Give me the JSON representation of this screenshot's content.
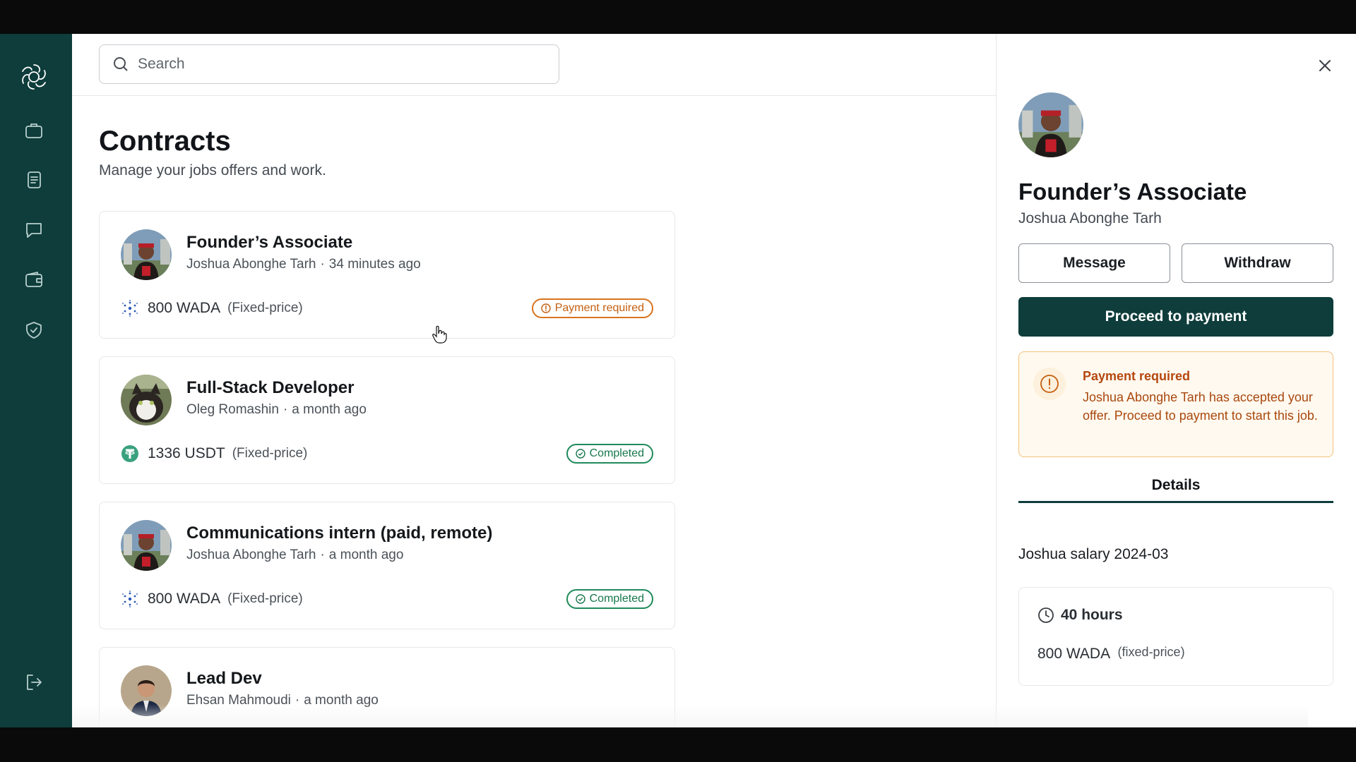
{
  "search": {
    "placeholder": "Search"
  },
  "sidebar": {
    "items": [
      {
        "icon": "briefcase-icon"
      },
      {
        "icon": "document-icon"
      },
      {
        "icon": "chat-icon"
      },
      {
        "icon": "wallet-icon"
      },
      {
        "icon": "shield-check-icon"
      }
    ],
    "logout_icon": "logout-icon"
  },
  "main": {
    "title": "Contracts",
    "subtitle": "Manage your jobs offers and work.",
    "contracts": [
      {
        "title": "Founder’s Associate",
        "person": "Joshua Abonghe Tarh",
        "time": "34 minutes ago",
        "amount": "800 WADA",
        "type": "(Fixed-price)",
        "coin": "cardano",
        "status": "Payment required"
      },
      {
        "title": "Full-Stack Developer",
        "person": "Oleg Romashin",
        "time": "a month ago",
        "amount": "1336 USDT",
        "type": "(Fixed-price)",
        "coin": "tether",
        "status": "Completed"
      },
      {
        "title": "Communications intern (paid, remote)",
        "person": "Joshua Abonghe Tarh",
        "time": "a month ago",
        "amount": "800 WADA",
        "type": "(Fixed-price)",
        "coin": "cardano",
        "status": "Completed"
      },
      {
        "title": "Lead Dev",
        "person": "Ehsan Mahmoudi",
        "time": "a month ago"
      }
    ],
    "separator": "·"
  },
  "panel": {
    "title": "Founder’s Associate",
    "name": "Joshua Abonghe Tarh",
    "message_label": "Message",
    "withdraw_label": "Withdraw",
    "proceed_label": "Proceed to payment",
    "alert": {
      "title": "Payment required",
      "text": "Joshua Abonghe Tarh has accepted your offer. Proceed to payment to start this job."
    },
    "tab_label": "Details",
    "contract_name": "Joshua salary 2024-03",
    "hours": "40 hours",
    "amount": "800 WADA",
    "amount_type": "(fixed-price)"
  },
  "colors": {
    "sidebar": "#0e3d3b",
    "primary": "#0e3d3b",
    "warning": "#d9731e",
    "success": "#1f8a5a"
  }
}
